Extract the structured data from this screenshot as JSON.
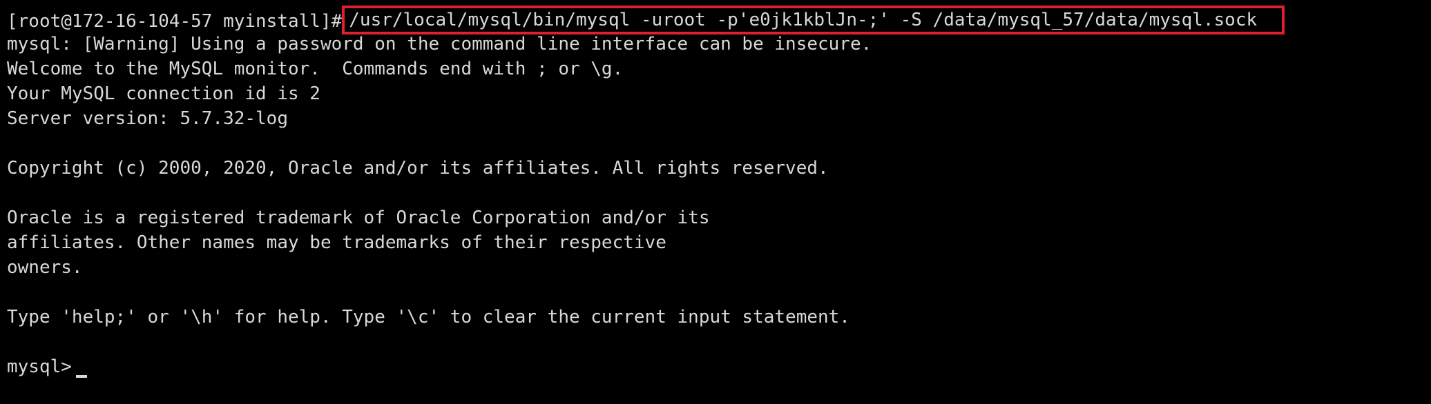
{
  "terminal": {
    "prompt_line": {
      "prompt": "[root@172-16-104-57 myinstall]#",
      "command": "/usr/local/mysql/bin/mysql -uroot -p'e0jk1kblJn-;' -S /data/mysql_57/data/mysql.sock"
    },
    "lines": [
      "mysql: [Warning] Using a password on the command line interface can be insecure.",
      "Welcome to the MySQL monitor.  Commands end with ; or \\g.",
      "Your MySQL connection id is 2",
      "Server version: 5.7.32-log",
      "",
      "Copyright (c) 2000, 2020, Oracle and/or its affiliates. All rights reserved.",
      "",
      "Oracle is a registered trademark of Oracle Corporation and/or its",
      "affiliates. Other names may be trademarks of their respective",
      "owners.",
      "",
      "Type 'help;' or '\\h' for help. Type '\\c' to clear the current input statement.",
      ""
    ],
    "mysql_prompt": "mysql>",
    "highlight_color": "#e0202a"
  }
}
